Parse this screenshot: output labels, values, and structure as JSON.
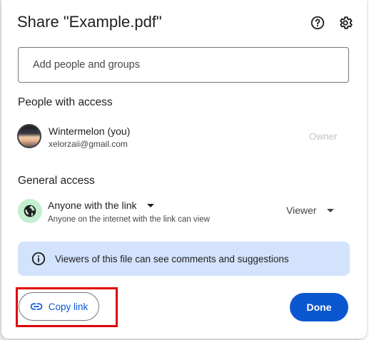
{
  "dialog": {
    "title": "Share \"Example.pdf\"",
    "help_icon": "help-circle-icon",
    "settings_icon": "gear-icon"
  },
  "search": {
    "placeholder": "Add people and groups"
  },
  "people_with_access": {
    "heading": "People with access",
    "users": [
      {
        "name": "Wintermelon (you)",
        "email": "xelorzaii@gmail.com",
        "role": "Owner"
      }
    ]
  },
  "general_access": {
    "heading": "General access",
    "mode": "Anyone with the link",
    "description": "Anyone on the internet with the link can view",
    "role": "Viewer"
  },
  "info_banner": {
    "text": "Viewers of this file can see comments and suggestions"
  },
  "footer": {
    "copy_link_label": "Copy link",
    "done_label": "Done"
  },
  "colors": {
    "primary": "#0b57d0",
    "banner_bg": "#d3e3fd",
    "globe_bg": "#c4eed0",
    "highlight": "#e00000"
  }
}
